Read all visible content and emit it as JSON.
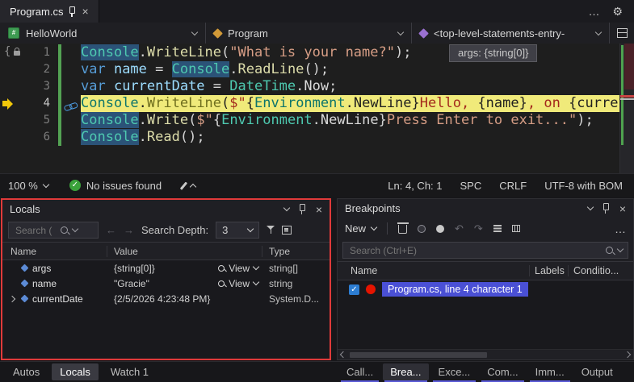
{
  "window": {
    "tab": {
      "title": "Program.cs"
    }
  },
  "icons": {
    "more": "…",
    "gear": "⚙",
    "close": "×",
    "check": "✓",
    "back": "←",
    "forward": "→",
    "undo": "↶",
    "redo": "↷",
    "ellipsis": "…"
  },
  "navbar": {
    "project": "HelloWorld",
    "type": "Program",
    "member": "<top-level-statements-entry-"
  },
  "editor": {
    "datatip": "args: {string[0]}",
    "lines": [
      {
        "n": "1",
        "cur": false,
        "tokens": [
          {
            "t": "Console",
            "c": "cls hl"
          },
          {
            "t": ".",
            "c": "p"
          },
          {
            "t": "WriteLine",
            "c": "m"
          },
          {
            "t": "(",
            "c": "p"
          },
          {
            "t": "\"What is your name?\"",
            "c": "str"
          },
          {
            "t": ");",
            "c": "p"
          }
        ]
      },
      {
        "n": "2",
        "cur": false,
        "tokens": [
          {
            "t": "var ",
            "c": "kw"
          },
          {
            "t": "name ",
            "c": "id"
          },
          {
            "t": "= ",
            "c": "p"
          },
          {
            "t": "Console",
            "c": "cls hl"
          },
          {
            "t": ".",
            "c": "p"
          },
          {
            "t": "ReadLine",
            "c": "m"
          },
          {
            "t": "();",
            "c": "p"
          }
        ]
      },
      {
        "n": "3",
        "cur": false,
        "tokens": [
          {
            "t": "var ",
            "c": "kw"
          },
          {
            "t": "currentDate ",
            "c": "id"
          },
          {
            "t": "= ",
            "c": "p"
          },
          {
            "t": "DateTime",
            "c": "cls"
          },
          {
            "t": ".",
            "c": "p"
          },
          {
            "t": "Now",
            "c": "prop"
          },
          {
            "t": ";",
            "c": "p"
          }
        ]
      },
      {
        "n": "4",
        "cur": true,
        "tokens": [
          {
            "t": "Console",
            "c": "y-cls"
          },
          {
            "t": ".",
            "c": "y-p"
          },
          {
            "t": "WriteLine",
            "c": "y-m"
          },
          {
            "t": "(",
            "c": "y-p"
          },
          {
            "t": "$\"",
            "c": "y-str"
          },
          {
            "t": "{",
            "c": "y-p"
          },
          {
            "t": "Environment",
            "c": "y-cls"
          },
          {
            "t": ".",
            "c": "y-p"
          },
          {
            "t": "NewLine",
            "c": "y-p"
          },
          {
            "t": "}",
            "c": "y-p"
          },
          {
            "t": "Hello, ",
            "c": "y-str"
          },
          {
            "t": "{",
            "c": "y-p"
          },
          {
            "t": "name",
            "c": "y-id"
          },
          {
            "t": "}",
            "c": "y-p"
          },
          {
            "t": ", on ",
            "c": "y-str"
          },
          {
            "t": "{currentDate",
            "c": "y-p"
          }
        ]
      },
      {
        "n": "5",
        "cur": false,
        "tokens": [
          {
            "t": "Console",
            "c": "cls hl"
          },
          {
            "t": ".",
            "c": "p"
          },
          {
            "t": "Write",
            "c": "m"
          },
          {
            "t": "(",
            "c": "p"
          },
          {
            "t": "$\"",
            "c": "str"
          },
          {
            "t": "{",
            "c": "p"
          },
          {
            "t": "Environment",
            "c": "cls"
          },
          {
            "t": ".",
            "c": "p"
          },
          {
            "t": "NewLine",
            "c": "prop"
          },
          {
            "t": "}",
            "c": "p"
          },
          {
            "t": "Press Enter to exit...\"",
            "c": "str"
          },
          {
            "t": ");",
            "c": "p"
          }
        ]
      },
      {
        "n": "6",
        "cur": false,
        "tokens": [
          {
            "t": "Console",
            "c": "cls hl"
          },
          {
            "t": ".",
            "c": "p"
          },
          {
            "t": "Read",
            "c": "m"
          },
          {
            "t": "();",
            "c": "p"
          }
        ]
      }
    ]
  },
  "statusbar": {
    "zoom": "100 %",
    "issues": "No issues found",
    "position": "Ln: 4, Ch: 1",
    "spaces": "SPC",
    "line_endings": "CRLF",
    "encoding": "UTF-8 with BOM"
  },
  "locals": {
    "title": "Locals",
    "search_placeholder": "Search (",
    "depth_label": "Search Depth:",
    "depth_value": "3",
    "columns": {
      "name": "Name",
      "value": "Value",
      "type": "Type"
    },
    "rows": [
      {
        "name": "args",
        "value": "{string[0]}",
        "view": "View",
        "type": "string[]"
      },
      {
        "name": "name",
        "value": "\"Gracie\"",
        "view": "View",
        "type": "string"
      },
      {
        "name": "currentDate",
        "value": "{2/5/2026 4:23:48 PM}",
        "type": "System.D..."
      }
    ]
  },
  "left_tabs": {
    "autos": "Autos",
    "locals": "Locals",
    "watch": "Watch 1"
  },
  "breakpoints": {
    "title": "Breakpoints",
    "new_label": "New",
    "search_placeholder": "Search (Ctrl+E)",
    "columns": {
      "name": "Name",
      "labels": "Labels",
      "condition": "Conditio..."
    },
    "row": {
      "label": "Program.cs, line 4 character 1"
    }
  },
  "right_tabs": {
    "call": "Call...",
    "breakpoints": "Brea...",
    "exceptions": "Exce...",
    "command": "Com...",
    "immediate": "Imm...",
    "output": "Output"
  },
  "colors": {
    "annotation_border": "#E03A3A",
    "current_statement": "#F0EA7A",
    "breakpoint_red": "#E51400",
    "selection_blue": "#4A50D5",
    "issues_green": "#3AA23A",
    "change_track_green": "#53A253"
  }
}
